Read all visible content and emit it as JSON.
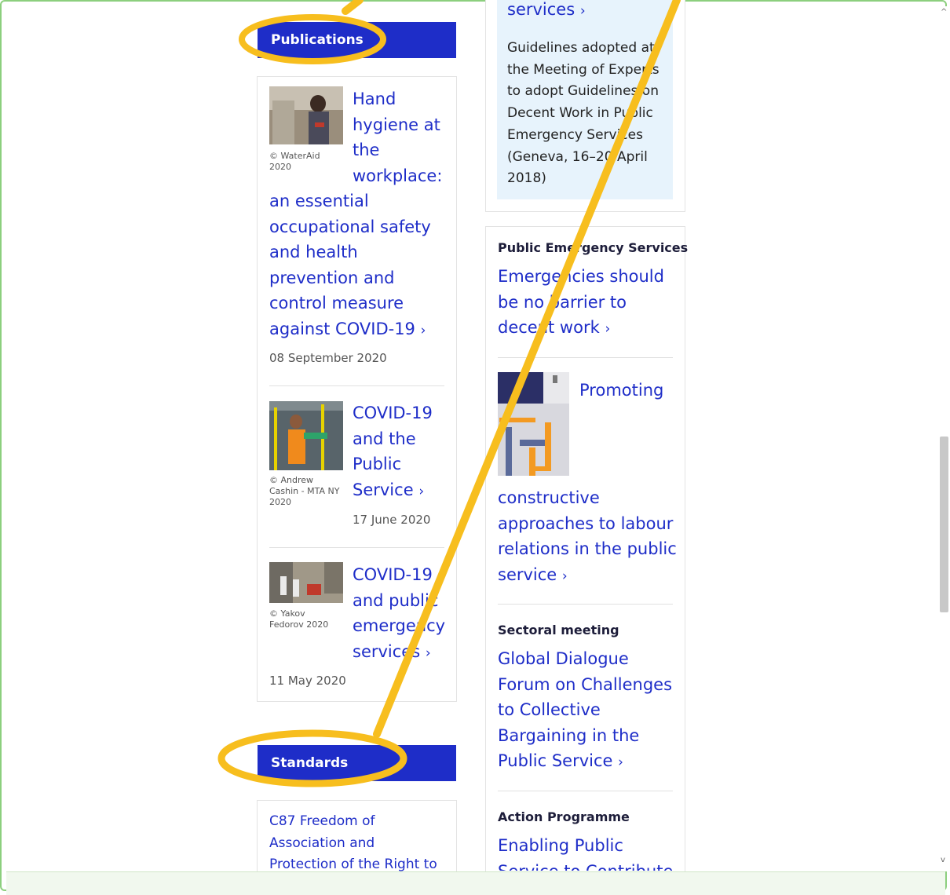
{
  "publications": {
    "header": "Publications",
    "items": [
      {
        "title": "Hand hygiene at the workplace: an essential occupational safety and health prevention and control measure against COVID-19",
        "title_lines": [
          "Hand",
          "hygiene at",
          "the",
          "workplace:",
          "an essential",
          "occupational safety",
          "and health",
          "prevention and",
          "control measure",
          "against COVID-19"
        ],
        "chevron": "›",
        "credit_lines": [
          "© WaterAid",
          "2020"
        ],
        "date": "08 September 2020"
      },
      {
        "title": "COVID-19 and the Public Service",
        "title_lines": [
          "COVID-19",
          "and the",
          "Public",
          "Service"
        ],
        "chevron": "›",
        "credit_lines": [
          "© Andrew",
          "Cashin - MTA NY",
          "2020"
        ],
        "date": "17 June 2020"
      },
      {
        "title": "COVID-19 and public emergency services",
        "title_lines": [
          "COVID-19",
          "and public",
          "emergency",
          "services"
        ],
        "chevron": "›",
        "credit_lines": [
          "© Yakov",
          "Fedorov 2020"
        ],
        "date": "11 May 2020"
      }
    ]
  },
  "standards": {
    "header": "Standards",
    "first_item_lines": [
      "C87 Freedom of",
      "Association and",
      "Protection of the Right to"
    ]
  },
  "right_column": {
    "top_link_partial": "services",
    "chevron": "›",
    "guidelines_lines": [
      "Guidelines adopted at",
      "the Meeting of Experts",
      "to adopt Guidelines on",
      "Decent Work in Public",
      "Emergency Services",
      "(Geneva, 16–20 April",
      "2018)"
    ],
    "items": [
      {
        "label": "Public Emergency Services",
        "link_lines": [
          "Emergencies should",
          "be no barrier to",
          "decent work"
        ]
      },
      {
        "label": "",
        "link_lines_top": [
          "Promoting"
        ],
        "link_lines": [
          "constructive",
          "approaches to labour",
          "relations in the public",
          "service"
        ]
      },
      {
        "label": "Sectoral meeting",
        "link_lines": [
          "Global Dialogue",
          "Forum on Challenges",
          "to Collective",
          "Bargaining in the",
          "Public Service"
        ]
      },
      {
        "label": "Action Programme",
        "link_lines": [
          "Enabling Public",
          "Service to Contribute"
        ]
      }
    ]
  },
  "annotation": {
    "color": "#f7be1e"
  }
}
